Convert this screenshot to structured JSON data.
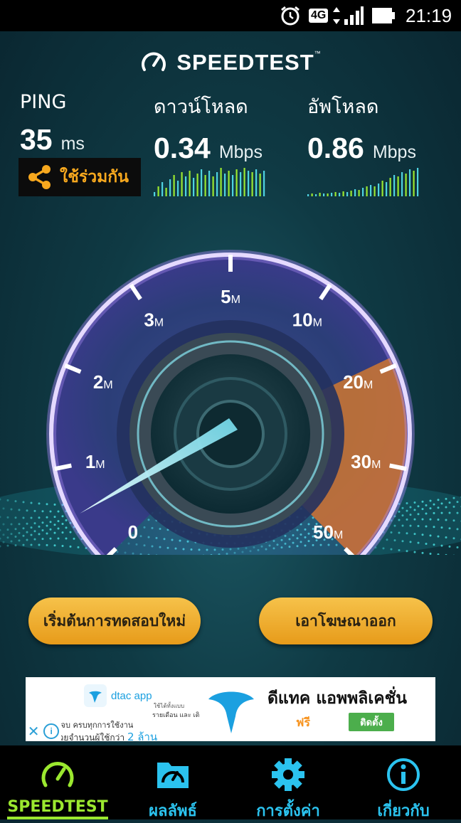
{
  "status_bar": {
    "time": "21:19",
    "network": "4G",
    "icons": [
      "alarm-icon",
      "signal-icon",
      "battery-icon"
    ]
  },
  "header": {
    "title": "SPEEDTEST",
    "tm": "™"
  },
  "results": {
    "ping": {
      "label": "PING",
      "value": "35",
      "unit": "ms"
    },
    "download": {
      "label": "ดาวน์โหลด",
      "value": "0.34",
      "unit": "Mbps"
    },
    "upload": {
      "label": "อัพโหลด",
      "value": "0.86",
      "unit": "Mbps"
    }
  },
  "share": {
    "label": "ใช้ร่วมกัน"
  },
  "gauge": {
    "ticks": [
      {
        "n": "0",
        "u": ""
      },
      {
        "n": "1",
        "u": "M"
      },
      {
        "n": "2",
        "u": "M"
      },
      {
        "n": "3",
        "u": "M"
      },
      {
        "n": "5",
        "u": "M"
      },
      {
        "n": "10",
        "u": "M"
      },
      {
        "n": "20",
        "u": "M"
      },
      {
        "n": "30",
        "u": "M"
      },
      {
        "n": "50",
        "u": "M"
      }
    ]
  },
  "actions": {
    "retest": "เริ่มต้นการทดสอบใหม่",
    "remove_ads": "เอาโฆษณาออก"
  },
  "ad": {
    "brand": "dtac app",
    "line1": "ใช้ได้ทั้งแบบ",
    "line2": "รายเดือน และ เติมเงิน",
    "line3": "เดียวจบ ครบทุกการใช้งาน",
    "line4": "ใจด้วยจำนวนผู้ใช้กว่า",
    "line4_highlight": "2 ล้าน",
    "headline": "ดีแทค แอพพลิเคชั่น",
    "price": "ฟรี",
    "install": "ติดตั้ง"
  },
  "nav": [
    {
      "label": "SPEEDTEST",
      "icon": "speedometer-icon",
      "active": true
    },
    {
      "label": "ผลลัพธ์",
      "icon": "results-folder-icon",
      "active": false
    },
    {
      "label": "การตั้งค่า",
      "icon": "gear-icon",
      "active": false
    },
    {
      "label": "เกี่ยวกับ",
      "icon": "info-icon",
      "active": false
    }
  ],
  "colors": {
    "accent": "#f7a81e",
    "nav_active": "#9be82f",
    "nav_inactive": "#2bc3ef",
    "gauge_edge": "#b592ff"
  }
}
